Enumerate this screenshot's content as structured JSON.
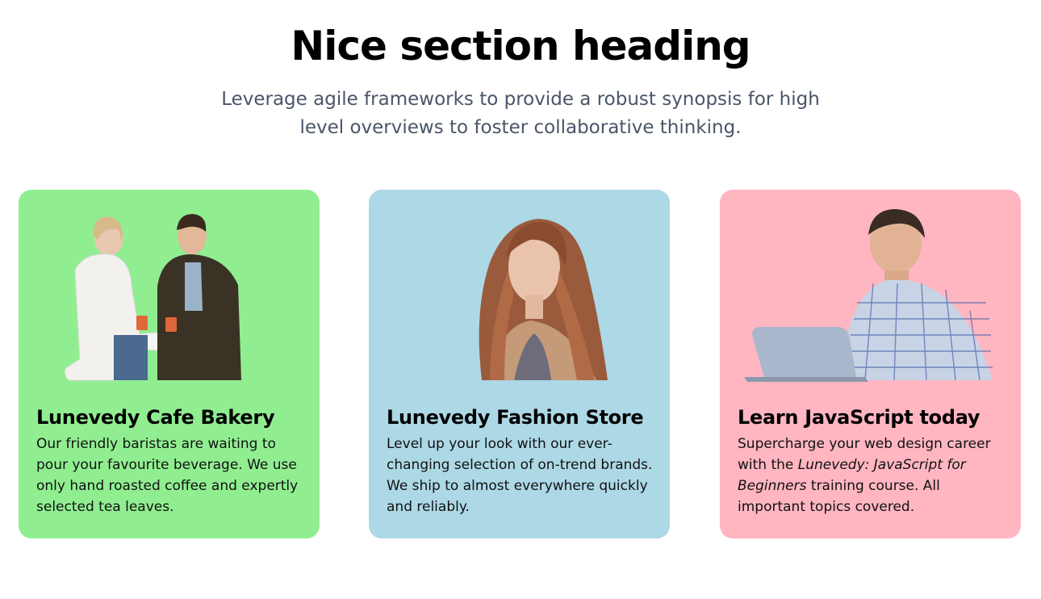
{
  "section": {
    "heading": "Nice section heading",
    "subtext": "Leverage agile frameworks to provide a robust synopsis for high level overviews to foster collaborative thinking."
  },
  "cards": [
    {
      "color": "#90ee90",
      "image_alt": "two people drinking coffee",
      "title": "Lunevedy Cafe Bakery",
      "text": "Our friendly baristas are waiting to pour your favourite beverage. We use only hand roasted coffee and expertly selected tea leaves."
    },
    {
      "color": "#add8e6",
      "image_alt": "woman with long hair",
      "title": "Lunevedy Fashion Store",
      "text": "Level up your look with our ever-changing selection of on-trend brands. We ship to almost everywhere quickly and reliably."
    },
    {
      "color": "#ffb6c1",
      "image_alt": "man with laptop",
      "title": "Learn JavaScript today",
      "text_before": "Supercharge your web design career with the ",
      "text_em": "Lunevedy: JavaScript for Beginners",
      "text_after": " training course. All important topics covered."
    }
  ]
}
